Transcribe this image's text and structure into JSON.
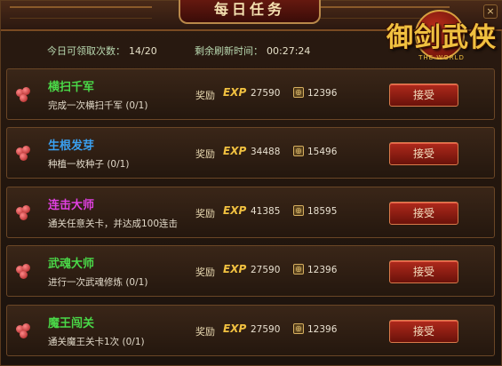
{
  "header": {
    "title": "每日任务",
    "close": "×"
  },
  "logo": {
    "text": "御剑武侠",
    "sub": "THE WORLD"
  },
  "info": {
    "count_label": "今日可领取次数：",
    "count_value": "14/20",
    "refresh_label": "剩余刷新时间：",
    "refresh_value": "00:27:24"
  },
  "tasks": [
    {
      "name": "横扫千军",
      "desc": "完成一次横扫千军 (0/1)",
      "reward_label": "奖励",
      "exp_label": "EXP",
      "exp": "27590",
      "coin": "12396",
      "button": "接受",
      "name_color": "#4ad848"
    },
    {
      "name": "生根发芽",
      "desc": "种植一枚种子 (0/1)",
      "reward_label": "奖励",
      "exp_label": "EXP",
      "exp": "34488",
      "coin": "15496",
      "button": "接受",
      "name_color": "#3aa0f0"
    },
    {
      "name": "连击大师",
      "desc": "通关任意关卡，并达成100连击",
      "reward_label": "奖励",
      "exp_label": "EXP",
      "exp": "41385",
      "coin": "18595",
      "button": "接受",
      "name_color": "#e040e0"
    },
    {
      "name": "武魂大师",
      "desc": "进行一次武魂修炼 (0/1)",
      "reward_label": "奖励",
      "exp_label": "EXP",
      "exp": "27590",
      "coin": "12396",
      "button": "接受",
      "name_color": "#4ad848"
    },
    {
      "name": "魔王闯关",
      "desc": "通关魔王关卡1次 (0/1)",
      "reward_label": "奖励",
      "exp_label": "EXP",
      "exp": "27590",
      "coin": "12396",
      "button": "接受",
      "name_color": "#4ad848"
    }
  ]
}
